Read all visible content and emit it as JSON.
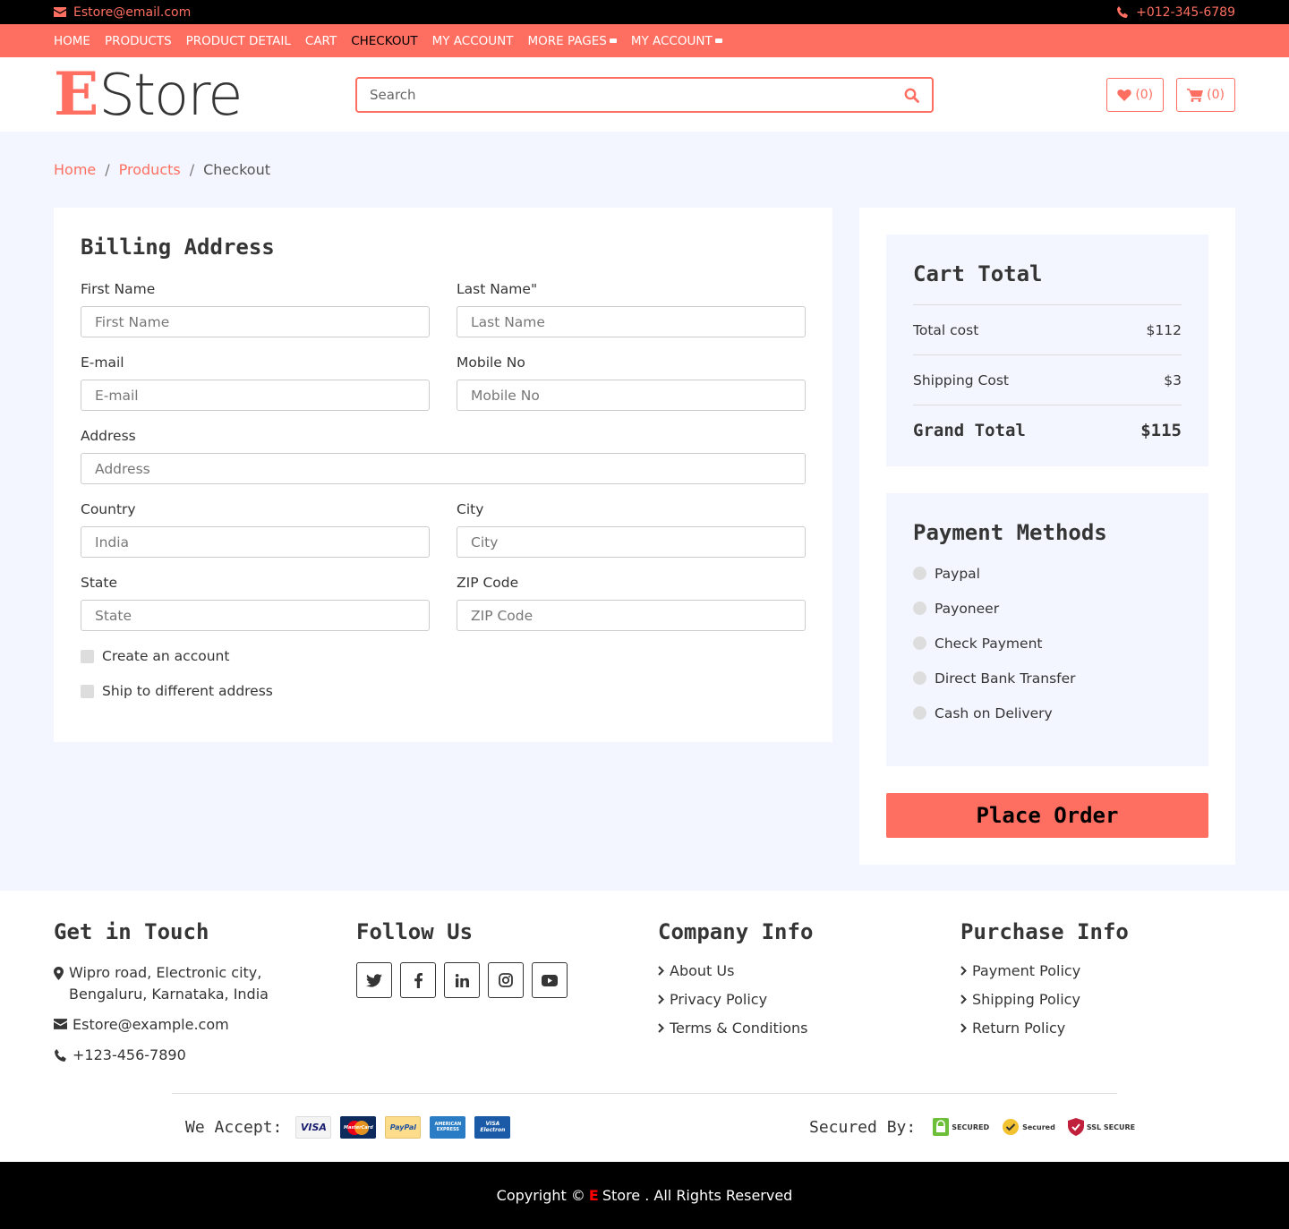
{
  "topbar": {
    "email": "Estore@email.com",
    "phone": "+012-345-6789"
  },
  "nav": [
    {
      "label": "Home"
    },
    {
      "label": "Products"
    },
    {
      "label": "Product Detail"
    },
    {
      "label": "Cart"
    },
    {
      "label": "Checkout",
      "active": true
    },
    {
      "label": "My Account"
    },
    {
      "label": "More Pages",
      "dropdown": true
    },
    {
      "label": "My Account",
      "dropdown": true
    }
  ],
  "header": {
    "logo_e": "E",
    "logo_rest": "Store",
    "search_placeholder": "Search",
    "wishlist_count": "(0)",
    "cart_count": "(0)"
  },
  "breadcrumb": {
    "home": "Home",
    "products": "Products",
    "current": "Checkout",
    "sep": "/"
  },
  "billing": {
    "title": "Billing Address",
    "first_name_label": "First Name",
    "first_name_placeholder": "First Name",
    "last_name_label": "Last Name\"",
    "last_name_placeholder": "Last Name",
    "email_label": "E-mail",
    "email_placeholder": "E-mail",
    "mobile_label": "Mobile No",
    "mobile_placeholder": "Mobile No",
    "address_label": "Address",
    "address_placeholder": "Address",
    "country_label": "Country",
    "country_value": "India",
    "city_label": "City",
    "city_placeholder": "City",
    "state_label": "State",
    "state_placeholder": "State",
    "zip_label": "ZIP Code",
    "zip_placeholder": "ZIP Code",
    "create_account": "Create an account",
    "ship_different": "Ship to different address"
  },
  "cart": {
    "title": "Cart Total",
    "total_cost_label": "Total cost",
    "total_cost": "$112",
    "shipping_label": "Shipping Cost",
    "shipping": "$3",
    "grand_label": "Grand Total",
    "grand": "$115"
  },
  "payment": {
    "title": "Payment Methods",
    "methods": [
      "Paypal",
      "Payoneer",
      "Check Payment",
      "Direct Bank Transfer",
      "Cash on Delivery"
    ]
  },
  "place_order": "Place Order",
  "footer": {
    "touch_title": "Get in Touch",
    "address": "Wipro road, Electronic city, Bengaluru, Karnataka, India",
    "email": "Estore@example.com",
    "phone": "+123-456-7890",
    "follow_title": "Follow Us",
    "company_title": "Company Info",
    "company_links": [
      "About Us",
      "Privacy Policy",
      "Terms & Conditions"
    ],
    "purchase_title": "Purchase Info",
    "purchase_links": [
      "Payment Policy",
      "Shipping Policy",
      "Return Policy"
    ],
    "accept_label": "We Accept:",
    "cards": [
      "VISA",
      "MasterCard",
      "PayPal",
      "AMERICAN EXPRESS",
      "VISA Electron"
    ],
    "secured_label": "Secured By:",
    "seals": [
      "SECURED",
      "Secured",
      "SSL SECURE"
    ]
  },
  "copyright": {
    "pre": "Copyright ©",
    "e": "E",
    "post": "Store . All Rights Reserved"
  },
  "colors": {
    "accent": "#FF6F61",
    "page_bg": "#F3F6FF",
    "text": "#353535"
  }
}
